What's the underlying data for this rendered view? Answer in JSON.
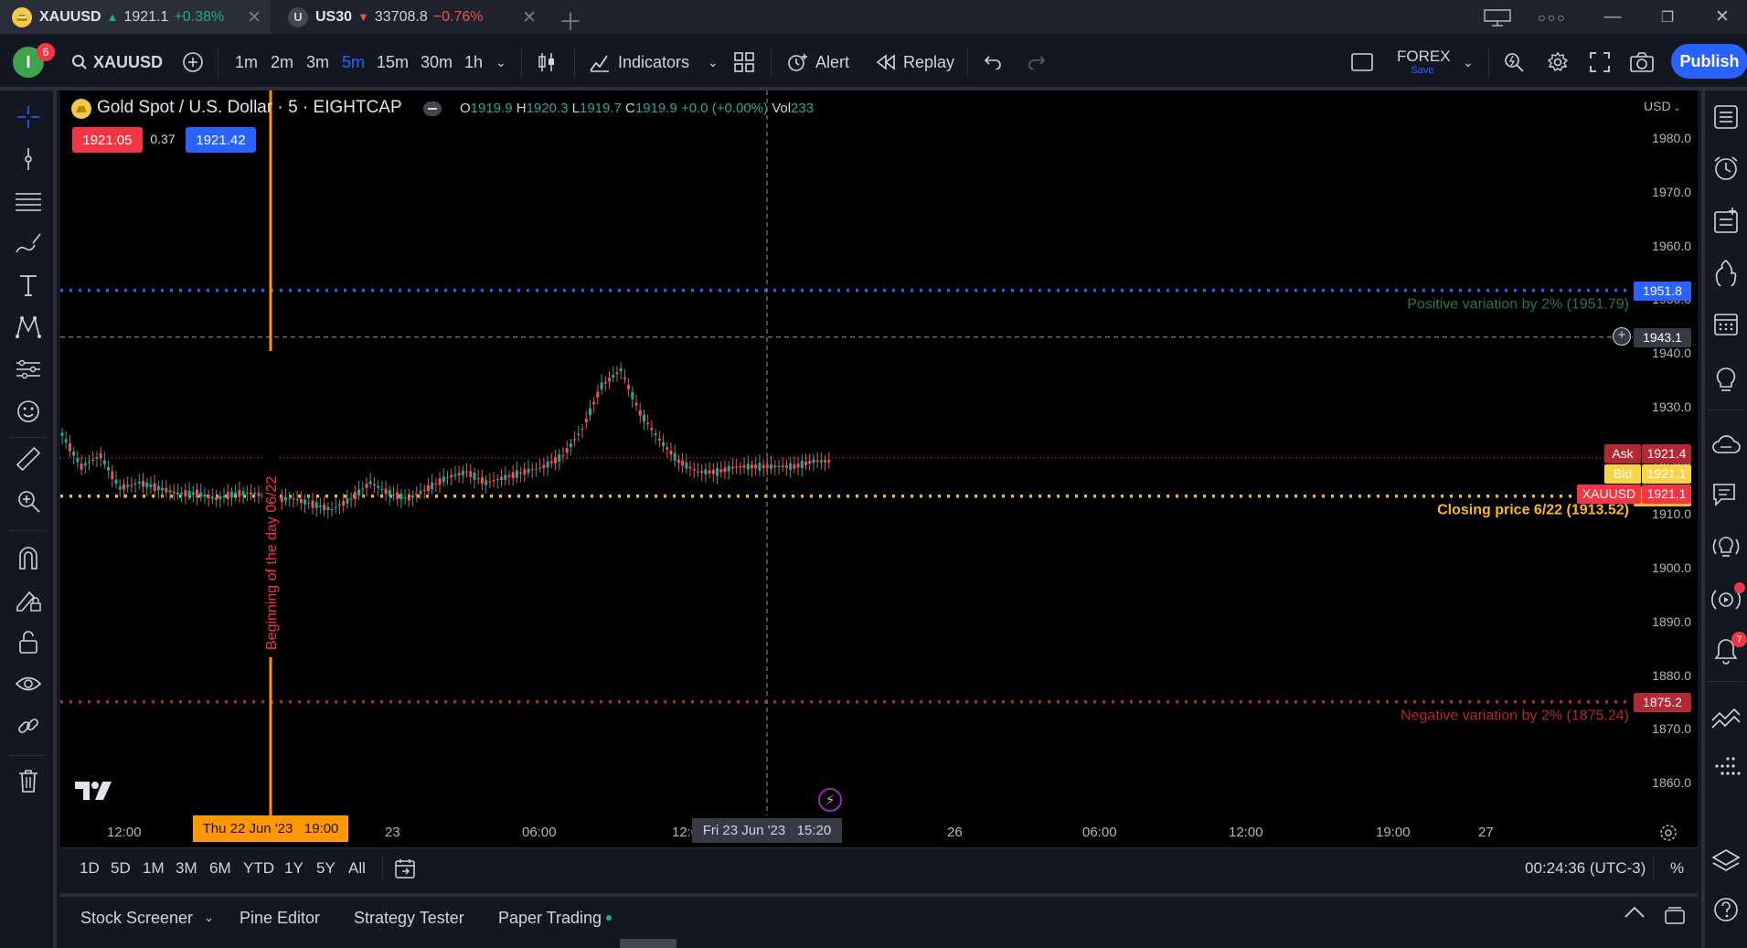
{
  "browser_tabs": [
    {
      "symbol": "XAUUSD",
      "arrow": "▲",
      "price": "1921.1",
      "change": "+0.38%",
      "direction": "up",
      "logo_letter": ""
    },
    {
      "symbol": "US30",
      "arrow": "▼",
      "price": "33708.8",
      "change": "−0.76%",
      "direction": "down",
      "logo_letter": "U"
    }
  ],
  "toolbar": {
    "avatar_letter": "I",
    "notification_count": "6",
    "symbol": "XAUUSD",
    "intervals": [
      "1m",
      "2m",
      "3m",
      "5m",
      "15m",
      "30m",
      "1h"
    ],
    "active_interval": "5m",
    "indicators_label": "Indicators",
    "alert_label": "Alert",
    "replay_label": "Replay",
    "layout_name": "FOREX",
    "layout_status": "Save",
    "publish_label": "Publish"
  },
  "legend": {
    "title": "Gold Spot / U.S. Dollar · 5 · EIGHTCAP",
    "ohlc": [
      {
        "key": "O",
        "value": "1919.9"
      },
      {
        "key": "H",
        "value": "1920.3"
      },
      {
        "key": "L",
        "value": "1919.7"
      },
      {
        "key": "C",
        "value": "1919.9"
      }
    ],
    "change": "+0.0 (+0.00%)",
    "vol_label": "Vol",
    "volume": "233",
    "sell_price": "1921.05",
    "spread": "0.37",
    "buy_price": "1921.42"
  },
  "currency": "USD",
  "chart_data": {
    "type": "candlestick",
    "symbol": "XAUUSD",
    "interval": "5",
    "y_ticks": [
      "1980.0",
      "1970.0",
      "1960.0",
      "1950.0",
      "1940.0",
      "1930.0",
      "1920.0",
      "1910.0",
      "1900.0",
      "1890.0",
      "1880.0",
      "1870.0",
      "1860.0"
    ],
    "ylim": [
      1856,
      1986
    ],
    "x_ticks": [
      "12:00",
      "23",
      "06:00",
      "12:00",
      "26",
      "06:00",
      "12:00",
      "19:00",
      "27"
    ],
    "approx_close_series": [
      1925,
      1919,
      1921,
      1915,
      1916,
      1915,
      1914,
      1914,
      1913,
      1914,
      1914,
      1913,
      1913,
      1912,
      1911,
      1913,
      1916,
      1914,
      1913,
      1915,
      1917,
      1918,
      1916,
      1917,
      1918,
      1919,
      1921,
      1926,
      1934,
      1937,
      1929,
      1924,
      1920,
      1918,
      1918,
      1919,
      1919,
      1919,
      1919,
      1920,
      1920
    ],
    "horizontal_lines": [
      {
        "price": "1951.8",
        "label": "Positive variation by 2% (1951.79)",
        "color": "#2962ff",
        "label_color": "#1f7a4c"
      },
      {
        "price": "1913.5",
        "label": "Closing price 6/22 (1913.52)",
        "color": "#f7b92b",
        "label_color": "#f7b92b"
      },
      {
        "price": "1875.2",
        "label": "Negative variation by 2% (1875.24)",
        "color": "#b22833",
        "label_color": "#b22833"
      }
    ],
    "vertical_line": {
      "label": "Beginning of the day 06/22",
      "color": "#ff9800",
      "date_label": "Thu 22 Jun '23   19:00"
    },
    "crosshair": {
      "price": "1943.1",
      "date_label": "Fri 23 Jun '23   15:20"
    },
    "price_labels": [
      {
        "text": "Ask",
        "value": "1921.4"
      },
      {
        "text": "Bid",
        "value": "1921.1"
      },
      {
        "text": "XAUUSD",
        "value": "1921.1"
      }
    ]
  },
  "range_buttons": [
    "1D",
    "5D",
    "1M",
    "3M",
    "6M",
    "YTD",
    "1Y",
    "5Y",
    "All"
  ],
  "clock": "00:24:36 (UTC-3)",
  "percent_toggle": "%",
  "bottom_tabs": [
    "Stock Screener",
    "Pine Editor",
    "Strategy Tester",
    "Paper Trading"
  ],
  "right_badge_count": "7"
}
